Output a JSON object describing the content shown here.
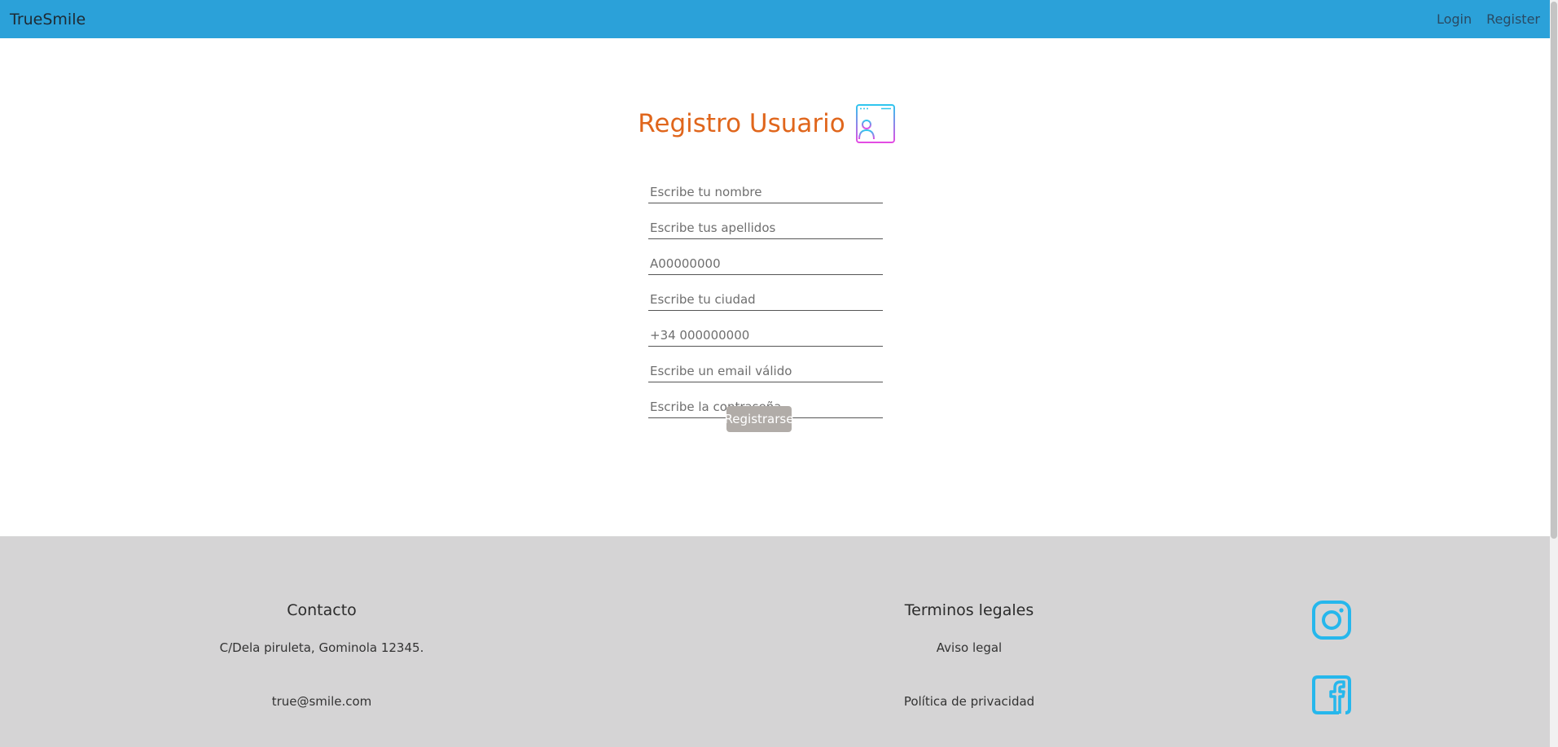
{
  "navbar": {
    "brand": "TrueSmile",
    "links": {
      "login": "Login",
      "register": "Register"
    }
  },
  "form": {
    "title": "Registro Usuario",
    "fields": {
      "nombre": {
        "placeholder": "Escribe tu nombre",
        "value": ""
      },
      "apellidos": {
        "placeholder": "Escribe tus apellidos",
        "value": ""
      },
      "dni": {
        "placeholder": "A00000000",
        "value": ""
      },
      "ciudad": {
        "placeholder": "Escribe tu ciudad",
        "value": ""
      },
      "telefono": {
        "placeholder": "+34 000000000",
        "value": ""
      },
      "email": {
        "placeholder": "Escribe un email válido",
        "value": ""
      },
      "password": {
        "placeholder": "Escribe la contraseña",
        "value": ""
      }
    },
    "submit_label": "Registrarse"
  },
  "footer": {
    "contact": {
      "heading": "Contacto",
      "address": "C/Dela piruleta, Gominola 12345.",
      "email": "true@smile.com"
    },
    "legal": {
      "heading": "Terminos legales",
      "notice": "Aviso legal",
      "privacy": "Política de privacidad"
    },
    "social": {
      "icons": [
        "instagram-icon",
        "facebook-icon"
      ]
    }
  },
  "colors": {
    "navbar_bg": "#2ba1d9",
    "title": "#e0661c",
    "button_bg": "#b1aca8",
    "footer_bg": "#d5d4d5",
    "social_icon": "#26b7ec"
  }
}
